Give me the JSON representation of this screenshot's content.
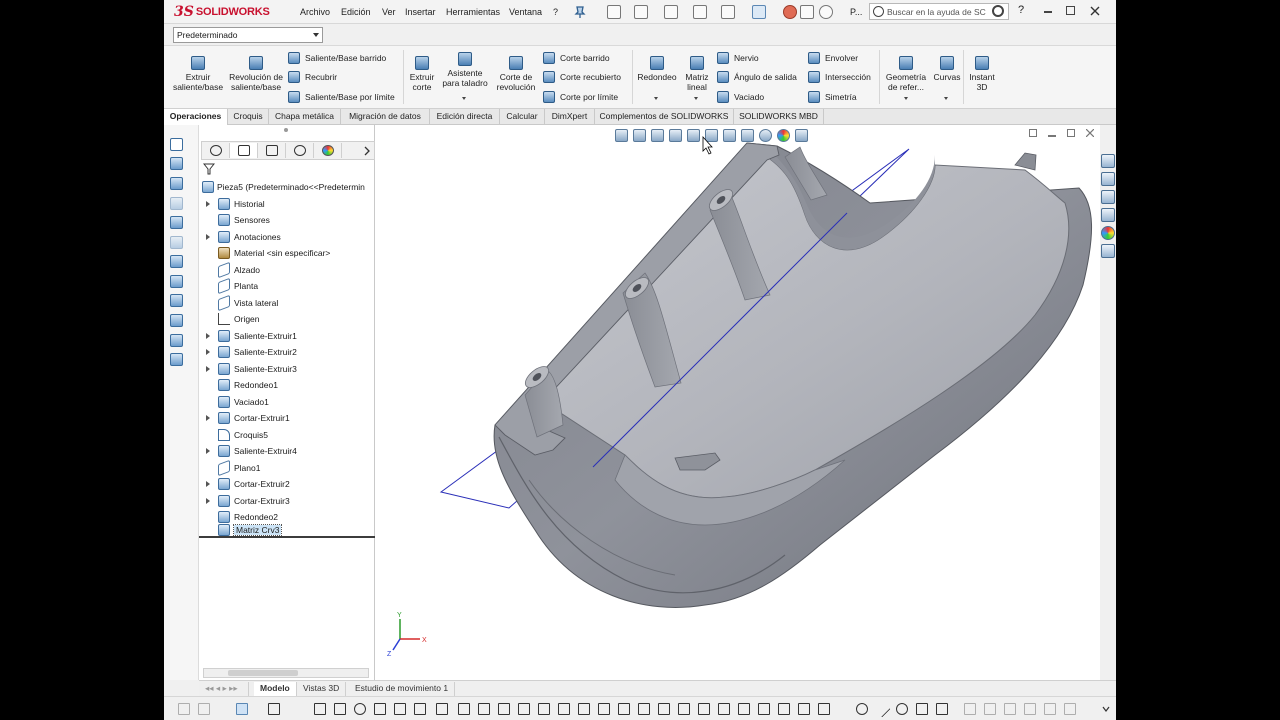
{
  "app": {
    "logo_ds": "3S",
    "logo_name": "SOLIDWORKS"
  },
  "menu": [
    "Archivo",
    "Edición",
    "Ver",
    "Insertar",
    "Herramientas",
    "Ventana",
    "?"
  ],
  "toolbar": {
    "part_abbrev": "P...",
    "search_placeholder": "Buscar en la ayuda de SC",
    "help": "?"
  },
  "config": {
    "selected": "Predeterminado"
  },
  "ribbon": {
    "extrude_boss": "Extruir saliente/base",
    "revolve_boss": "Revolución de saliente/base",
    "swept_boss": "Saliente/Base barrido",
    "lofted_boss": "Recubrir",
    "boundary_boss": "Saliente/Base por límite",
    "extrude_cut": "Extruir corte",
    "hole_wizard": "Asistente para taladro",
    "revolve_cut": "Corte de revolución",
    "swept_cut": "Corte barrido",
    "lofted_cut": "Corte recubierto",
    "boundary_cut": "Corte por límite",
    "fillet": "Redondeo",
    "linear_pattern": "Matriz lineal",
    "rib": "Nervio",
    "draft": "Ángulo de salida",
    "shell": "Vaciado",
    "wrap": "Envolver",
    "intersect": "Intersección",
    "mirror": "Simetría",
    "ref_geometry": "Geometría de refer...",
    "curves": "Curvas",
    "instant3d": "Instant 3D"
  },
  "tabs": [
    "Operaciones",
    "Croquis",
    "Chapa metálica",
    "Migración de datos",
    "Edición directa",
    "Calcular",
    "DimXpert",
    "Complementos de SOLIDWORKS",
    "SOLIDWORKS MBD"
  ],
  "tree": {
    "root": "Pieza5  (Predeterminado<<Predetermin",
    "items": [
      "Historial",
      "Sensores",
      "Anotaciones",
      "Material <sin especificar>",
      "Alzado",
      "Planta",
      "Vista lateral",
      "Origen",
      "Saliente-Extruir1",
      "Saliente-Extruir2",
      "Saliente-Extruir3",
      "Redondeo1",
      "Vaciado1",
      "Cortar-Extruir1",
      "Croquis5",
      "Saliente-Extruir4",
      "Plano1",
      "Cortar-Extruir2",
      "Cortar-Extruir3",
      "Redondeo2",
      "Matriz Crv3"
    ]
  },
  "triad": {
    "x": "X",
    "y": "Y",
    "z": "Z"
  },
  "bottom_tabs": [
    "Modelo",
    "Vistas 3D",
    "Estudio de movimiento 1"
  ],
  "colors": {
    "accent": "#c8102e",
    "model_gray": "#8f9299",
    "plane_line": "#2a2fb8"
  }
}
